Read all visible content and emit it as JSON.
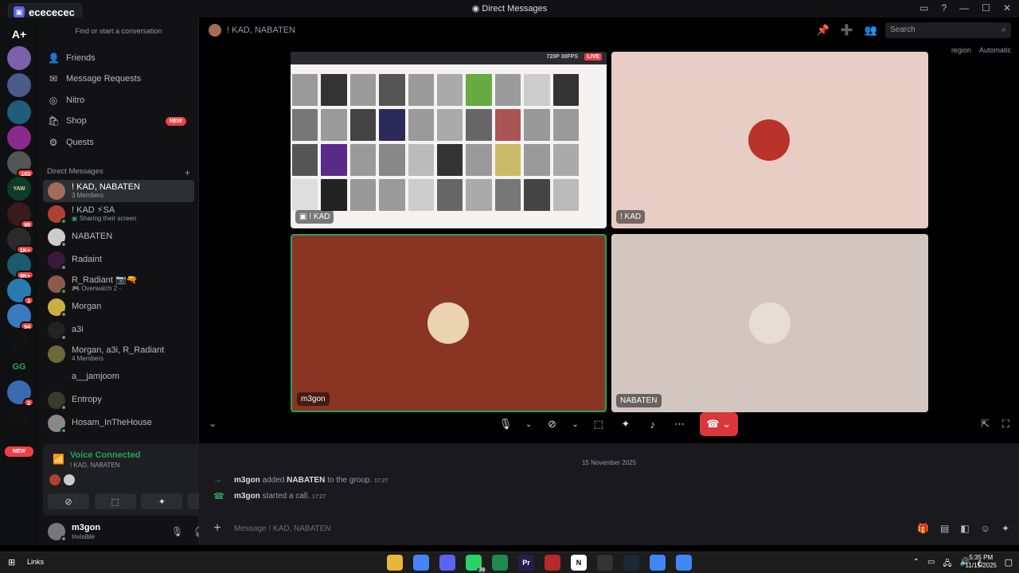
{
  "window": {
    "app_tag": "ecececec",
    "title": "Direct Messages",
    "controls": [
      "—",
      "☐",
      "✕"
    ]
  },
  "rail": {
    "top_label": "A+",
    "badges": [
      "103",
      "95",
      "1K+",
      "9K+",
      "3",
      "94",
      "2"
    ],
    "new_label": "NEW",
    "text_servers": [
      "YAW",
      "GG"
    ]
  },
  "sidebar": {
    "search_placeholder": "Find or start a conversation",
    "nav": [
      {
        "label": "Friends",
        "icon": "friends-icon"
      },
      {
        "label": "Message Requests",
        "icon": "mail-icon"
      },
      {
        "label": "Nitro",
        "icon": "nitro-icon"
      },
      {
        "label": "Shop",
        "icon": "shop-icon",
        "badge": "NEW"
      },
      {
        "label": "Quests",
        "icon": "quests-icon"
      }
    ],
    "dm_header": "Direct Messages",
    "dm_add": "+",
    "dms": [
      {
        "name": "! KAD, NABATEN",
        "sub": "3 Members",
        "active": true
      },
      {
        "name": "! KAD ⚡SA",
        "sub": "Sharing their screen",
        "sub_icon": "▣"
      },
      {
        "name": "NABATEN",
        "sub": ""
      },
      {
        "name": "Radaint",
        "sub": ""
      },
      {
        "name": "R_Radiant 📷🔫",
        "sub": "Overwatch 2 -",
        "sub_icon": "🎮"
      },
      {
        "name": "Morgan",
        "sub": ""
      },
      {
        "name": "a3i",
        "sub": ""
      },
      {
        "name": "Morgan, a3i, R_Radiant",
        "sub": "4 Members"
      },
      {
        "name": "a__jamjoom",
        "sub": ""
      },
      {
        "name": "Entropy",
        "sub": ""
      },
      {
        "name": "Hosam_InTheHouse",
        "sub": ""
      }
    ],
    "voice": {
      "status": "Voice Connected",
      "channel": "! KAD, NABATEN"
    },
    "user": {
      "name": "m3gon",
      "status": "Invisible"
    }
  },
  "main": {
    "channel_title": "! KAD, NABATEN",
    "search_placeholder": "Search",
    "region_label": "region",
    "region_value": "Automatic",
    "tiles": [
      {
        "name": "! KAD",
        "type": "screen-share",
        "quality": "720P 30FPS",
        "live": "LIVE"
      },
      {
        "name": "! KAD",
        "type": "avatar"
      },
      {
        "name": "m3gon",
        "type": "avatar",
        "speaking": true
      },
      {
        "name": "NABATEN",
        "type": "avatar"
      }
    ],
    "messages": {
      "date": "15 November 2025",
      "items": [
        {
          "actor": "m3gon",
          "text_before": " added ",
          "target": "NABATEN",
          "text_after": " to the group.",
          "time": "17:27",
          "icon": "arrow-right-icon"
        },
        {
          "actor": "m3gon",
          "text_before": " started a call.",
          "target": "",
          "text_after": "",
          "time": "17:27",
          "icon": "phone-icon"
        }
      ],
      "input_placeholder": "Message ! KAD, NABATEN"
    }
  },
  "taskbar": {
    "links_label": "Links",
    "time": "5:35 PM",
    "date": "11/15/2025",
    "lang": "ع",
    "badge_whatsapp": "39",
    "apps": [
      {
        "name": "file-explorer",
        "color": "#e8b63a",
        "label": ""
      },
      {
        "name": "chrome",
        "color": "#4285f4",
        "label": ""
      },
      {
        "name": "discord",
        "color": "#5865f2",
        "label": ""
      },
      {
        "name": "whatsapp",
        "color": "#25d366",
        "label": ""
      },
      {
        "name": "app-green",
        "color": "#1f8a4c",
        "label": ""
      },
      {
        "name": "premiere",
        "color": "#2a1b4d",
        "label": "Pr"
      },
      {
        "name": "video-editor",
        "color": "#b52a2a",
        "label": ""
      },
      {
        "name": "notion",
        "color": "#ffffff",
        "label": "N"
      },
      {
        "name": "app-circle",
        "color": "#333333",
        "label": ""
      },
      {
        "name": "steam",
        "color": "#1b2838",
        "label": ""
      },
      {
        "name": "chrome-2",
        "color": "#4285f4",
        "label": ""
      },
      {
        "name": "chrome-3",
        "color": "#4285f4",
        "label": ""
      }
    ]
  },
  "colors": {
    "accent": "#5865f2",
    "green": "#23a55a",
    "red": "#da373c",
    "bg_dark": "#121214"
  }
}
